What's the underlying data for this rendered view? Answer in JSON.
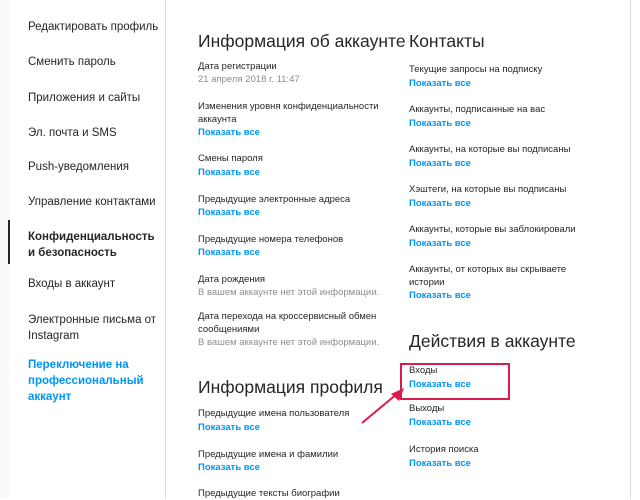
{
  "sidebar": {
    "items": [
      {
        "label": "Редактировать профиль"
      },
      {
        "label": "Сменить пароль"
      },
      {
        "label": "Приложения и сайты"
      },
      {
        "label": "Эл. почта и SMS"
      },
      {
        "label": "Push-уведомления"
      },
      {
        "label": "Управление контактами"
      },
      {
        "label": "Конфиденциальность и безопасность"
      },
      {
        "label": "Входы в аккаунт"
      },
      {
        "label": "Электронные письма от Instagram"
      },
      {
        "label": "Переключение на профессиональный аккаунт"
      }
    ]
  },
  "account_info": {
    "title": "Информация об аккаунте",
    "reg_label": "Дата регистрации",
    "reg_value": "21 апреля 2018 г. 11:47",
    "privacy_label": "Изменения уровня конфиденциальности аккаунта",
    "privacy_link": "Показать все",
    "password_label": "Смены пароля",
    "password_link": "Показать все",
    "emails_label": "Предыдущие электронные адреса",
    "emails_link": "Показать все",
    "phones_label": "Предыдущие номера телефонов",
    "phones_link": "Показать все",
    "birth_label": "Дата рождения",
    "birth_value": "В вашем аккаунте нет этой информации.",
    "crossservice_label": "Дата перехода на кроссервисный обмен сообщениями",
    "crossservice_value": "В вашем аккаунте нет этой информации."
  },
  "profile_info": {
    "title": "Информация профиля",
    "usernames_label": "Предыдущие имена пользователя",
    "usernames_link": "Показать все",
    "names_label": "Предыдущие имена и фамилии",
    "names_link": "Показать все",
    "bios_label": "Предыдущие тексты биографии"
  },
  "contacts": {
    "title": "Контакты",
    "requests_label": "Текущие запросы на подписку",
    "requests_link": "Показать все",
    "followers_label": "Аккаунты, подписанные на вас",
    "followers_link": "Показать все",
    "following_label": "Аккаунты, на которые вы подписаны",
    "following_link": "Показать все",
    "hashtags_label": "Хэштеги, на которые вы подписаны",
    "hashtags_link": "Показать все",
    "blocked_label": "Аккаунты, которые вы заблокировали",
    "blocked_link": "Показать все",
    "hidden_label": "Аккаунты, от которых вы скрываете истории",
    "hidden_link": "Показать все"
  },
  "actions": {
    "title": "Действия в аккаунте",
    "logins_label": "Входы",
    "logins_link": "Показать все",
    "logouts_label": "Выходы",
    "logouts_link": "Показать все",
    "search_label": "История поиска",
    "search_link": "Показать все"
  },
  "colors": {
    "link": "#0095f6",
    "highlight": "#d91c4d"
  }
}
